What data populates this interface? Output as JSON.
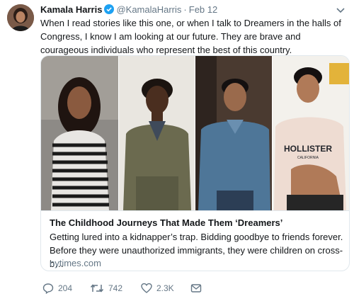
{
  "author": {
    "name": "Kamala Harris",
    "handle": "@KamalaHarris",
    "separator": "·",
    "date": "Feb 12"
  },
  "tweet": {
    "text": "When I read stories like this one, or when I talk to Dreamers in the halls of Congress, I know I am looking at our future. They are brave and courageous individuals who represent the best of this country."
  },
  "card": {
    "title": "The Childhood Journeys That Made Them ‘Dreamers’",
    "description": "Getting lured into a kidnapper’s trap. Bidding goodbye to friends forever. Before they were unauthorized immigrants, they were children on cross-b…",
    "domain": "nytimes.com",
    "shirt_text": "HOLLISTER",
    "shirt_subtext": "CALIFORNIA"
  },
  "actions": {
    "replies": "204",
    "retweets": "742",
    "likes": "2.3K"
  },
  "colors": {
    "verified": "#1da1f2",
    "secondary_text": "#657786",
    "border": "#e1e8ed"
  }
}
